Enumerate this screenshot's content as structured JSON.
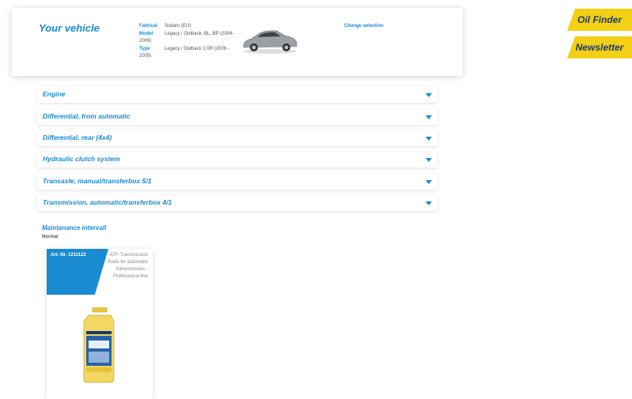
{
  "vehicle": {
    "title": "Your vehicle",
    "labels": {
      "fabrical": "Fabrical",
      "model": "Model",
      "type": "Type"
    },
    "values": {
      "fabrical": "Subaru (EU)",
      "model_line1": "Legacy / Outback, BL, BP (2004-",
      "model_line2": "2009)",
      "type_line1": "Legacy / Outback 2.0R (2006 -",
      "type_line2": "2009)"
    },
    "change_link": "Change selection"
  },
  "side": {
    "oil_finder": "Oil Finder",
    "newsletter": "Newsletter"
  },
  "accordion": [
    {
      "label": "Engine"
    },
    {
      "label": "Differential, from automatic"
    },
    {
      "label": "Differential, rear (4x4)"
    },
    {
      "label": "Hydraulic clutch system"
    },
    {
      "label": "Transaxle, manual/transferbox 5/1"
    },
    {
      "label": "Transmission, automatic/transferbox 4/1"
    }
  ],
  "maintenance": {
    "title": "Maintanance intervall",
    "subtitle": "Normal"
  },
  "product": {
    "art_nr": "Art.-Nr. 1211122",
    "description": "ATF-Transmission fluids for automatic transmissions - Professional line"
  },
  "colors": {
    "accent": "#1a8bd0",
    "yellow": "#f3d016",
    "navy": "#1b3a6b"
  }
}
